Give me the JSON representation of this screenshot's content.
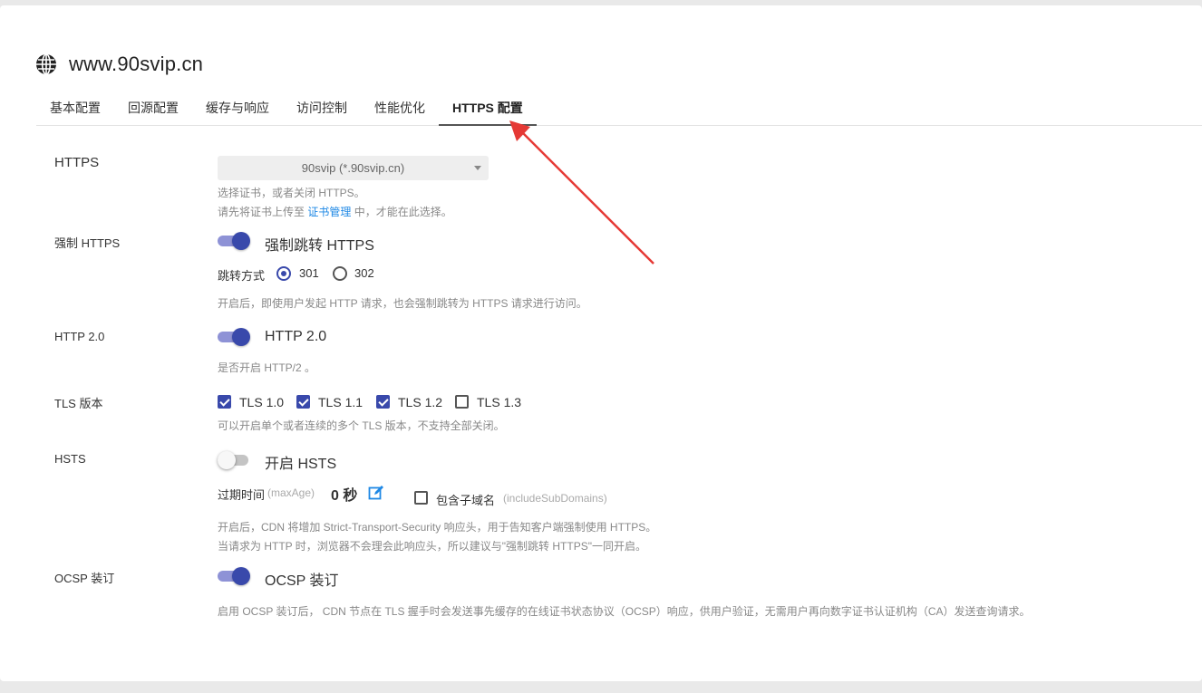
{
  "site": {
    "title": "www.90svip.cn",
    "icon": "globe-icon"
  },
  "tabs": [
    {
      "label": "基本配置"
    },
    {
      "label": "回源配置"
    },
    {
      "label": "缓存与响应"
    },
    {
      "label": "访问控制"
    },
    {
      "label": "性能优化"
    },
    {
      "label": "HTTPS 配置",
      "active": true
    }
  ],
  "https": {
    "label": "HTTPS",
    "selected_cert": "90svip (*.90svip.cn)",
    "help_line1": "选择证书，或者关闭 HTTPS。",
    "help_line2_prefix": "请先将证书上传至",
    "help_link": "证书管理",
    "help_line2_suffix": "中，才能在此选择。"
  },
  "force_https": {
    "label": "强制 HTTPS",
    "toggle_label": "强制跳转 HTTPS",
    "enabled": true,
    "redirect_label": "跳转方式",
    "options": [
      "301",
      "302"
    ],
    "selected": "301",
    "help": "开启后，即使用户发起 HTTP 请求，也会强制跳转为 HTTPS 请求进行访问。"
  },
  "http2": {
    "label": "HTTP 2.0",
    "toggle_label": "HTTP 2.0",
    "enabled": true,
    "help": "是否开启 HTTP/2 。"
  },
  "tls": {
    "label": "TLS 版本",
    "versions": [
      {
        "label": "TLS 1.0",
        "checked": true
      },
      {
        "label": "TLS 1.1",
        "checked": true
      },
      {
        "label": "TLS 1.2",
        "checked": true
      },
      {
        "label": "TLS 1.3",
        "checked": false
      }
    ],
    "help": "可以开启单个或者连续的多个 TLS 版本，不支持全部关闭。"
  },
  "hsts": {
    "label": "HSTS",
    "toggle_label": "开启 HSTS",
    "enabled": false,
    "max_age_label": "过期时间",
    "max_age_hint": "(maxAge)",
    "max_age_value": "0 秒",
    "subdomains_label": "包含子域名",
    "subdomains_hint": "(includeSubDomains)",
    "subdomains_checked": false,
    "help_line1": "开启后，CDN 将增加 Strict-Transport-Security 响应头，用于告知客户端强制使用 HTTPS。",
    "help_line2": "当请求为 HTTP 时，浏览器不会理会此响应头，所以建议与\"强制跳转 HTTPS\"一同开启。"
  },
  "ocsp": {
    "label": "OCSP 装订",
    "toggle_label": "OCSP 装订",
    "enabled": true,
    "help": "启用 OCSP 装订后， CDN 节点在 TLS 握手时会发送事先缓存的在线证书状态协议（OCSP）响应，供用户验证，无需用户再向数字证书认证机构（CA）发送查询请求。"
  },
  "colors": {
    "accent": "#3949ab",
    "link": "#1e88e5",
    "annotation": "#e53935"
  }
}
